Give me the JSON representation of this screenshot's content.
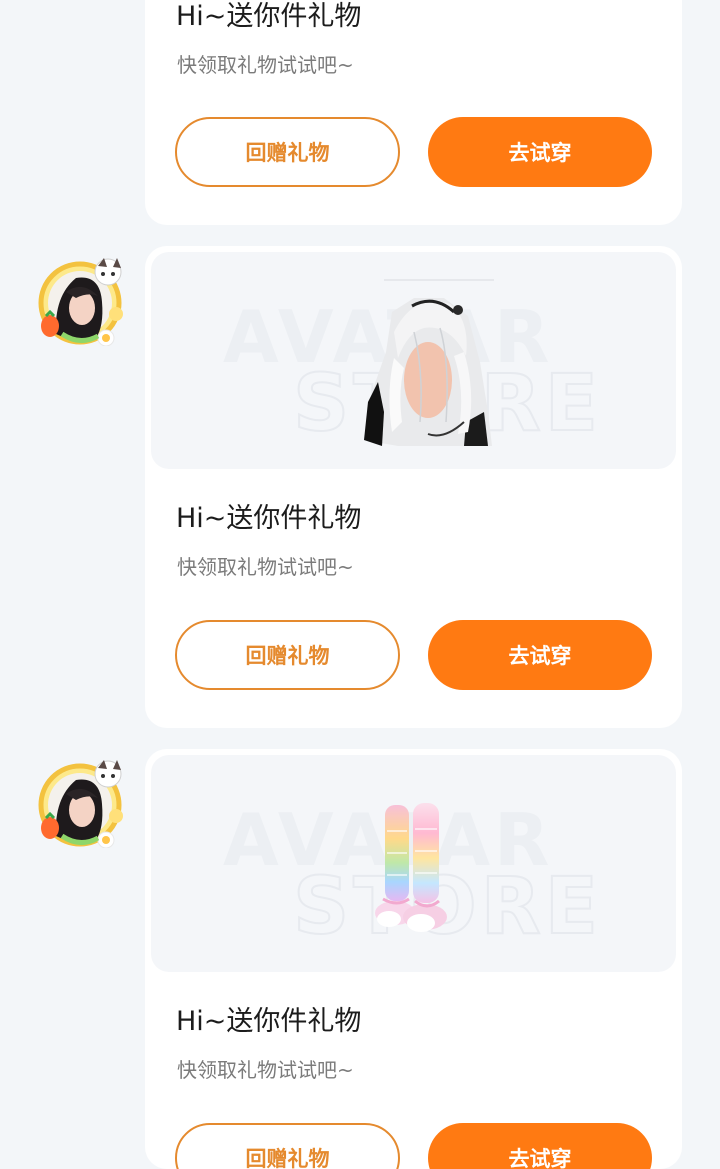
{
  "messages": [
    {
      "title": "Hi~送你件礼物",
      "subtitle": "快领取礼物试试吧~",
      "return_gift_label": "回赠礼物",
      "try_on_label": "去试穿"
    },
    {
      "title": "Hi~送你件礼物",
      "subtitle": "快领取礼物试试吧~",
      "return_gift_label": "回赠礼物",
      "try_on_label": "去试穿",
      "watermark_line1": "AVATAR",
      "watermark_line2": "STORE",
      "item_icon": "white-hair-icon"
    },
    {
      "title": "Hi~送你件礼物",
      "subtitle": "快领取礼物试试吧~",
      "return_gift_label": "回赠礼物",
      "try_on_label": "去试穿",
      "watermark_line1": "AVATAR",
      "watermark_line2": "STORE",
      "item_icon": "rainbow-leg-warmers-icon"
    }
  ],
  "colors": {
    "accent": "#ff7a12",
    "outline": "#e58a2e",
    "background": "#f3f6f9",
    "card": "#ffffff"
  }
}
